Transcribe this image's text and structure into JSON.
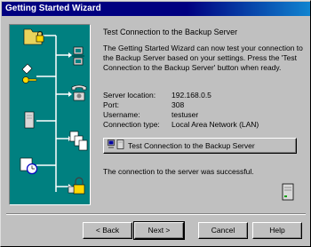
{
  "window": {
    "title": "Getting Started Wizard"
  },
  "page": {
    "heading": "Test Connection to the Backup Server",
    "description": "The Getting Started Wizard can now test your connection to the Backup Server based on your settings.  Press the 'Test Connection to the Backup Server' button when ready."
  },
  "info": [
    {
      "label": "Server location:",
      "value": "192.168.0.5"
    },
    {
      "label": "Port:",
      "value": "308"
    },
    {
      "label": "Username:",
      "value": "testuser"
    },
    {
      "label": "Connection type:",
      "value": "Local Area Network (LAN)"
    }
  ],
  "test_button": {
    "label": "Test Connection to the Backup Server"
  },
  "result": "The connection to the server was successful.",
  "buttons": {
    "back": "< Back",
    "next": "Next >",
    "cancel": "Cancel",
    "help": "Help"
  },
  "colors": {
    "title_bar": "#000080",
    "panel": "#008080",
    "face": "#c0c0c0"
  },
  "icons": [
    "folder-lock-icon",
    "network-computers-icon",
    "key-icon",
    "phone-icon",
    "server-icon",
    "documents-icon",
    "clock-icon",
    "padlock-icon"
  ]
}
